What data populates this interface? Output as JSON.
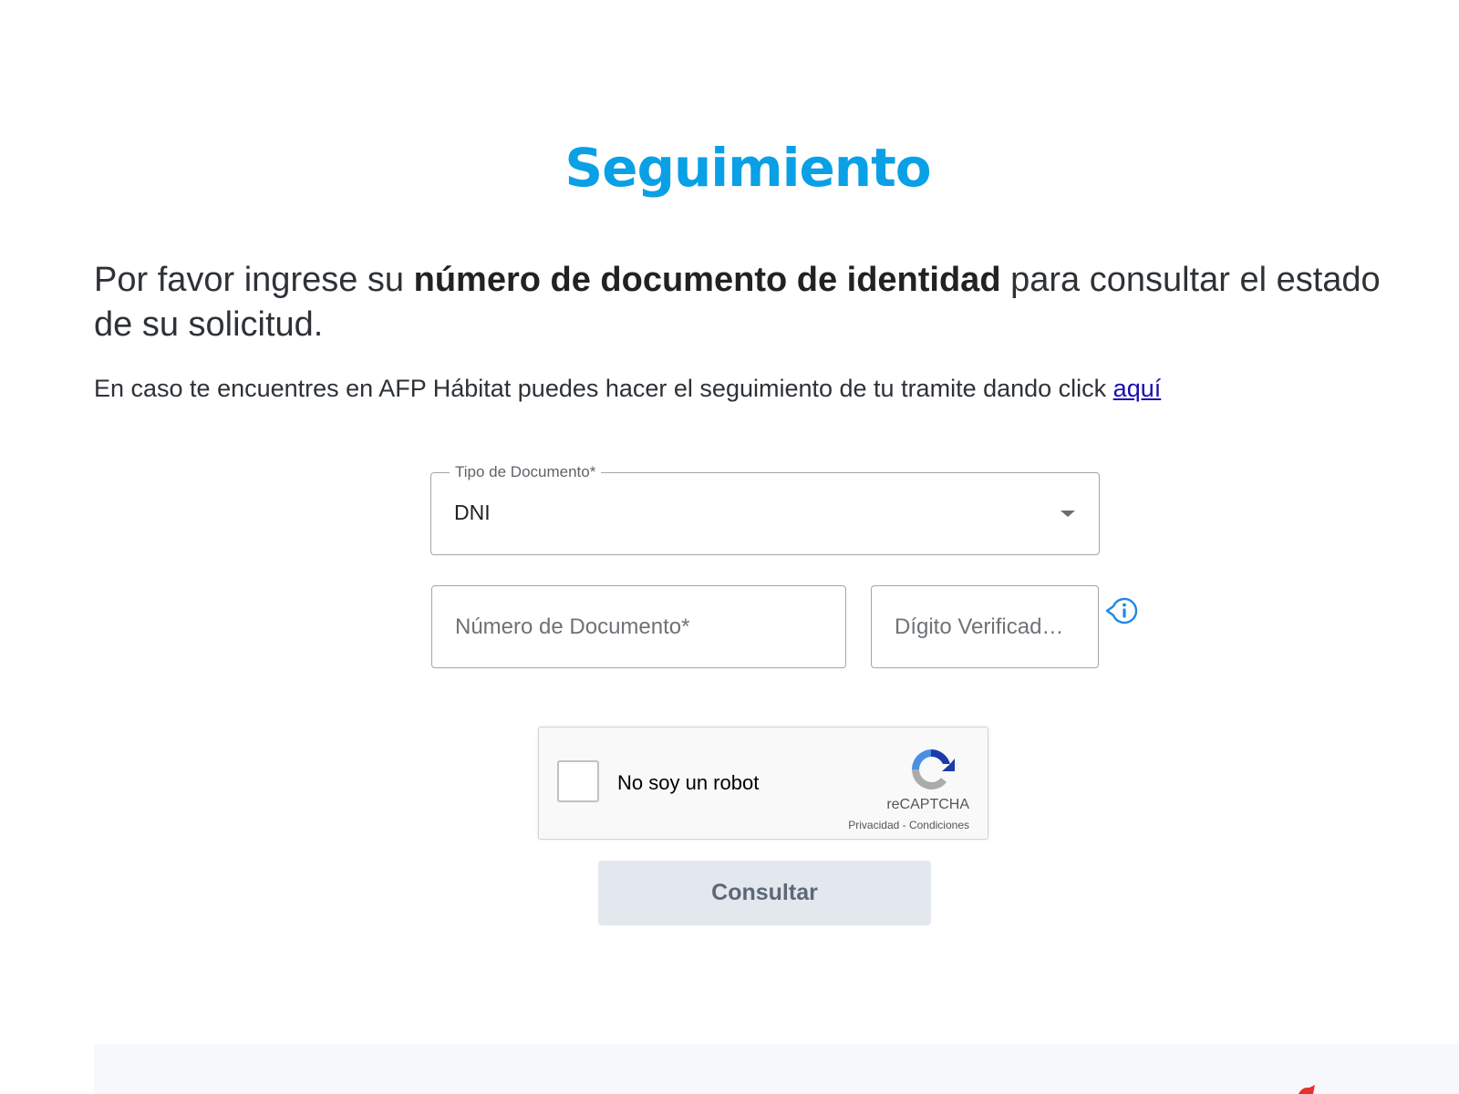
{
  "page": {
    "title": "Seguimiento"
  },
  "intro": {
    "text_before": "Por favor ingrese su ",
    "text_bold": "número de documento de identidad",
    "text_after": " para consultar el estado de su solicitud."
  },
  "note": {
    "text": "En caso te encuentres en AFP Hábitat puedes hacer el seguimiento de tu tramite dando click ",
    "link_label": "aquí"
  },
  "form": {
    "doc_type": {
      "label": "Tipo de Documento*",
      "selected": "DNI"
    },
    "doc_number": {
      "placeholder": "Número de Documento*",
      "value": ""
    },
    "check_digit": {
      "placeholder": "Dígito Verificad…",
      "value": ""
    },
    "submit_label": "Consultar"
  },
  "captcha": {
    "label": "No soy un robot",
    "brand": "reCAPTCHA",
    "terms": "Privacidad - Condiciones"
  },
  "colors": {
    "accent": "#0aa0e6",
    "link": "#1a0dab",
    "button_bg": "#e3e7ee",
    "button_text": "#5d6876",
    "info_icon": "#1e88e5",
    "footer_mark": "#e5322d"
  }
}
